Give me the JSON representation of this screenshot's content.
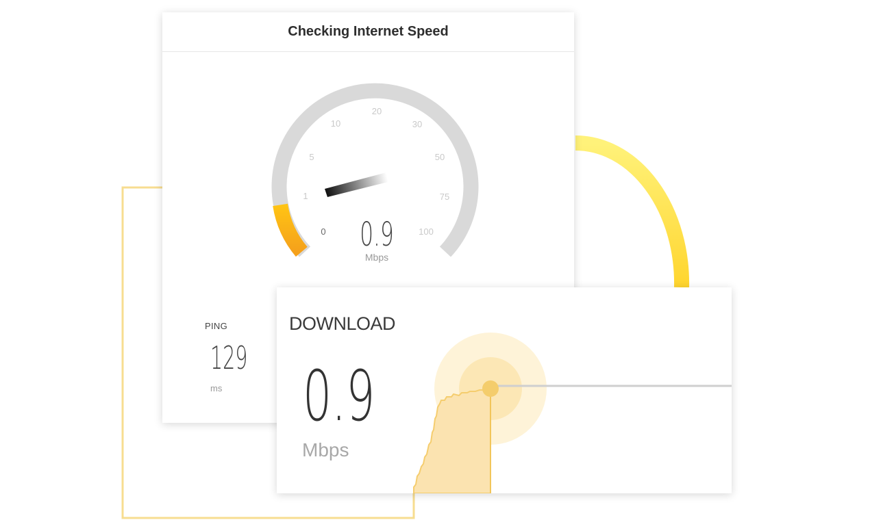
{
  "speedometer": {
    "title": "Checking Internet Speed",
    "ticks": [
      "0",
      "1",
      "5",
      "10",
      "20",
      "30",
      "50",
      "75",
      "100"
    ],
    "value": "0.9",
    "unit": "Mbps",
    "progress_fraction": 0.12
  },
  "ping": {
    "label": "PING",
    "value": "129",
    "unit": "ms"
  },
  "download": {
    "label": "DOWNLOAD",
    "value": "0.9",
    "unit": "Mbps"
  },
  "colors": {
    "accent_yellow": "#ffd93a",
    "accent_orange": "#f7a21b",
    "track_gray": "#d9d9d9",
    "chart_fill": "#fbe3b0"
  }
}
